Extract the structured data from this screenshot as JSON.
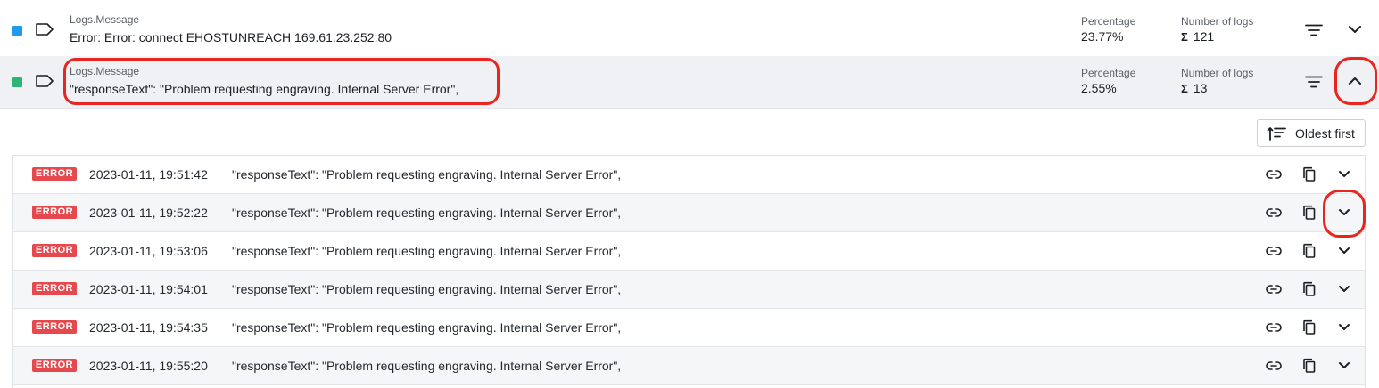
{
  "groups": [
    {
      "color": "#1e9bef",
      "field_label": "Logs.Message",
      "message": "Error: Error: connect EHOSTUNREACH 169.61.23.252:80",
      "percentage_label": "Percentage",
      "percentage": "23.77%",
      "count_label": "Number of logs",
      "count_symbol": "Σ",
      "count": "121",
      "expanded": false,
      "chevron_icon": "chevron-down-icon"
    },
    {
      "color": "#2bb673",
      "field_label": "Logs.Message",
      "message": "\"responseText\": \"Problem requesting engraving. Internal Server Error\",",
      "percentage_label": "Percentage",
      "percentage": "2.55%",
      "count_label": "Number of logs",
      "count_symbol": "Σ",
      "count": "13",
      "expanded": true,
      "chevron_icon": "chevron-up-icon"
    }
  ],
  "sort": {
    "label": "Oldest first",
    "icon": "sort-ascending-icon"
  },
  "logs": [
    {
      "level": "ERROR",
      "timestamp": "2023-01-11, 19:51:42",
      "message": "\"responseText\": \"Problem requesting engraving. Internal Server Error\","
    },
    {
      "level": "ERROR",
      "timestamp": "2023-01-11, 19:52:22",
      "message": "\"responseText\": \"Problem requesting engraving. Internal Server Error\","
    },
    {
      "level": "ERROR",
      "timestamp": "2023-01-11, 19:53:06",
      "message": "\"responseText\": \"Problem requesting engraving. Internal Server Error\","
    },
    {
      "level": "ERROR",
      "timestamp": "2023-01-11, 19:54:01",
      "message": "\"responseText\": \"Problem requesting engraving. Internal Server Error\","
    },
    {
      "level": "ERROR",
      "timestamp": "2023-01-11, 19:54:35",
      "message": "\"responseText\": \"Problem requesting engraving. Internal Server Error\","
    },
    {
      "level": "ERROR",
      "timestamp": "2023-01-11, 19:55:20",
      "message": "\"responseText\": \"Problem requesting engraving. Internal Server Error\","
    }
  ],
  "colors": {
    "error_badge": "#e5484d",
    "annotation": "#e8261f",
    "expanded_bg": "#eff1f4"
  }
}
